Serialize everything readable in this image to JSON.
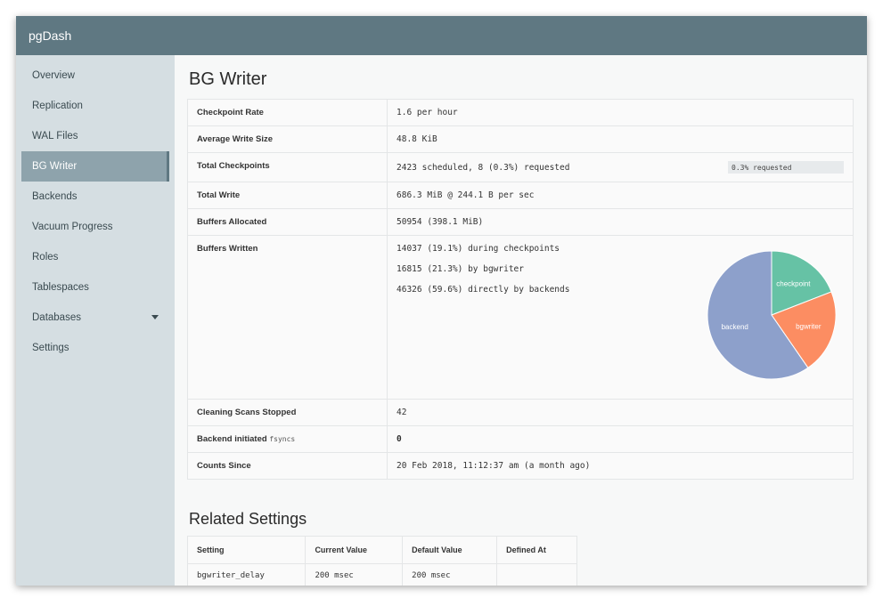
{
  "app": {
    "title": "pgDash"
  },
  "sidebar": {
    "items": [
      {
        "label": "Overview"
      },
      {
        "label": "Replication"
      },
      {
        "label": "WAL Files"
      },
      {
        "label": "BG Writer"
      },
      {
        "label": "Backends"
      },
      {
        "label": "Vacuum Progress"
      },
      {
        "label": "Roles"
      },
      {
        "label": "Tablespaces"
      },
      {
        "label": "Databases"
      },
      {
        "label": "Settings"
      }
    ],
    "active_index": 3
  },
  "page": {
    "title": "BG Writer"
  },
  "stats": {
    "checkpoint_rate": {
      "label": "Checkpoint Rate",
      "value": "1.6 per hour"
    },
    "avg_write_size": {
      "label": "Average Write Size",
      "value": "48.8 KiB"
    },
    "total_checkpoints": {
      "label": "Total Checkpoints",
      "value": "2423 scheduled, 8 (0.3%) requested",
      "badge": "0.3% requested"
    },
    "total_write": {
      "label": "Total Write",
      "value": "686.3 MiB @ 244.1 B per sec"
    },
    "buffers_allocated": {
      "label": "Buffers Allocated",
      "value": "50954 (398.1 MiB)"
    },
    "buffers_written": {
      "label": "Buffers Written",
      "lines": [
        "14037 (19.1%) during checkpoints",
        "16815 (21.3%) by bgwriter",
        "46326 (59.6%) directly by backends"
      ]
    },
    "cleaning_scans": {
      "label": "Cleaning Scans Stopped",
      "value": "42"
    },
    "backend_fsync": {
      "label": "Backend initiated",
      "label_small": "fsyncs",
      "value": "0"
    },
    "counts_since": {
      "label": "Counts Since",
      "value": "20 Feb 2018, 11:12:37 am (a month ago)"
    }
  },
  "chart_data": {
    "type": "pie",
    "categories": [
      "checkpoint",
      "bgwriter",
      "backend"
    ],
    "values": [
      19.1,
      21.3,
      59.6
    ],
    "colors": [
      "#66c2a5",
      "#fc8d62",
      "#8da0cb"
    ]
  },
  "related": {
    "title": "Related Settings",
    "headers": [
      "Setting",
      "Current Value",
      "Default Value",
      "Defined At"
    ],
    "rows": [
      [
        "bgwriter_delay",
        "200 msec",
        "200 msec",
        ""
      ]
    ]
  }
}
